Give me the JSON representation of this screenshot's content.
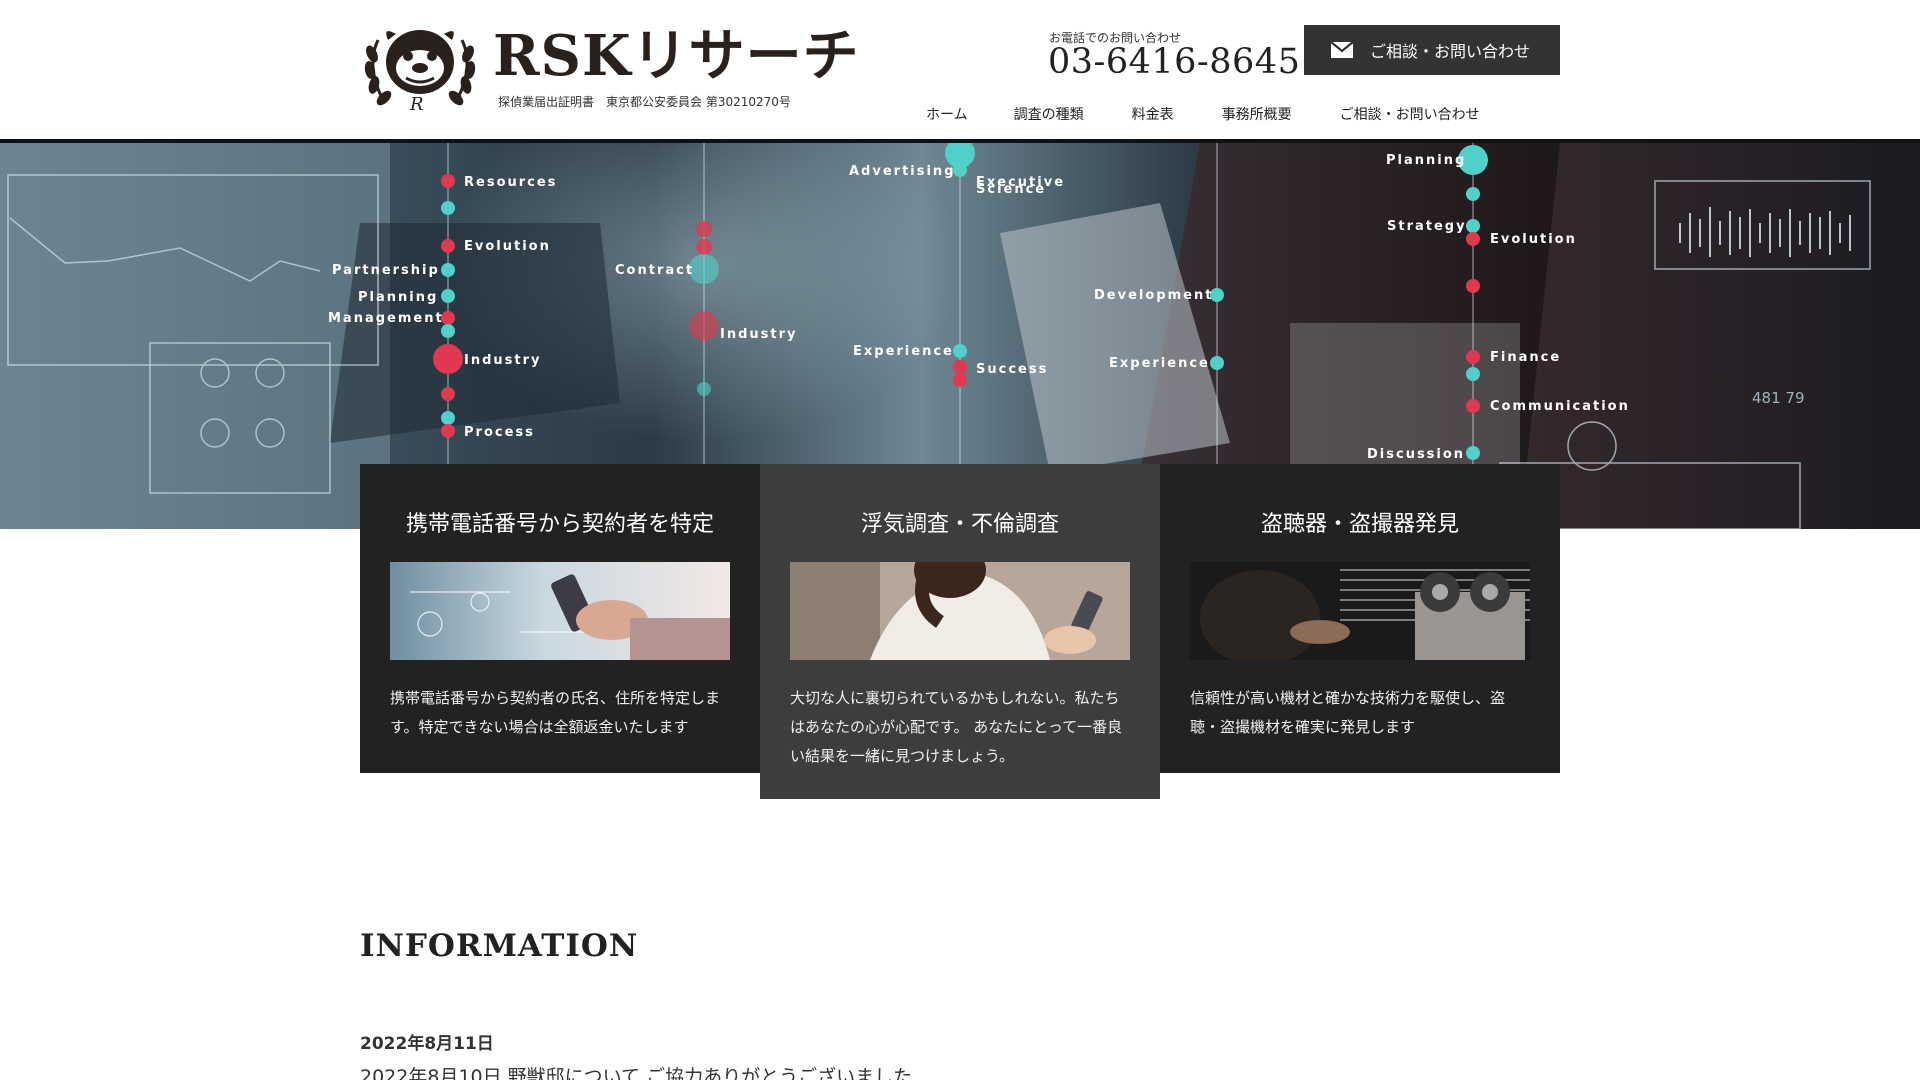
{
  "header": {
    "logo_text": "RSKリサーチ",
    "logo_sub": "探偵業届出証明書　東京都公安委員会 第30210270号",
    "tel_label": "お電話でのお問い合わせ",
    "tel_number": "03-6416-8645",
    "contact_button": "ご相談・お問い合わせ"
  },
  "nav": {
    "items": [
      "ホーム",
      "調査の種類",
      "料金表",
      "事務所概要",
      "ご相談・お問い合わせ"
    ]
  },
  "hero": {
    "labels": [
      "Resources",
      "Evolution",
      "Partnership",
      "Planning",
      "Management",
      "Industry",
      "Process",
      "Advertising",
      "Executive",
      "Science",
      "Contract",
      "Industry",
      "Experience",
      "Success",
      "Development",
      "Experience",
      "Planning",
      "Strategy",
      "Evolution",
      "Finance",
      "Communication",
      "Discussion",
      "481 79"
    ]
  },
  "cards": [
    {
      "title": "携帯電話番号から契約者を特定",
      "text": "携帯電話番号から契約者の氏名、住所を特定します。特定できない場合は全額返金いたします"
    },
    {
      "title": "浮気調査・不倫調査",
      "text": "大切な人に裏切られているかもしれない。私たちはあなたの心が心配です。 あなたにとって一番良い結果を一緒に見つけましょう。"
    },
    {
      "title": "盗聴器・盗撮器発見",
      "text": "信頼性が高い機材と確かな技術力を駆使し、盗聴・盗撮機材を確実に発見します"
    }
  ],
  "info": {
    "title": "INFORMATION",
    "date": "2022年8月11日",
    "text": "2022年8月10日 野獣邸について ご協力ありがとうございました"
  },
  "colors": {
    "accent_dark": "#333333",
    "card_dark": "#222222",
    "card_mid": "#3d3d3d",
    "hero_teal": "#4fd0c8",
    "hero_red": "#e0394f"
  },
  "icons": [
    "bulldog-emblem-icon",
    "mail-icon"
  ]
}
